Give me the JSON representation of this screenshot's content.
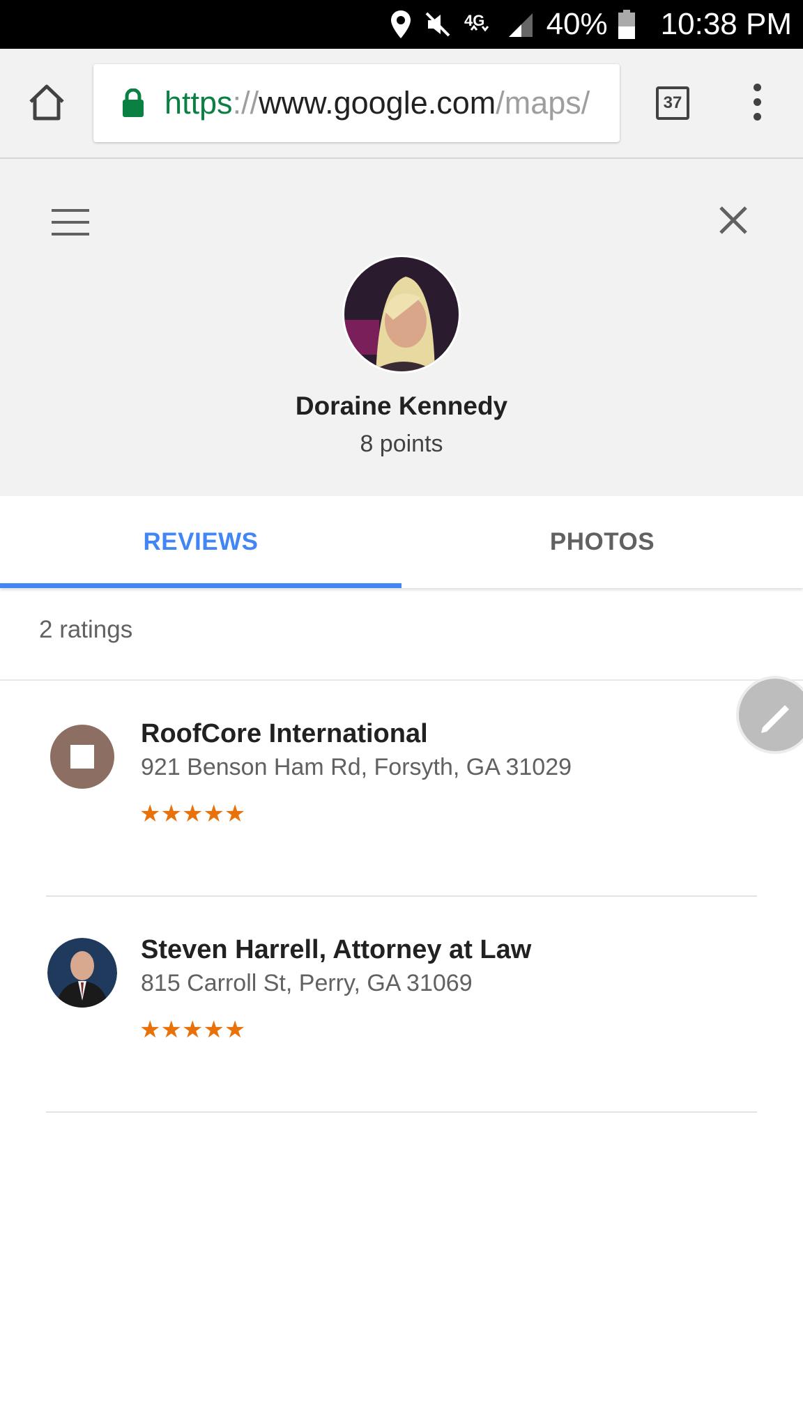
{
  "status_bar": {
    "battery_percent": "40%",
    "time": "10:38 PM",
    "network": "4G LTE",
    "icons": [
      "location-icon",
      "mute-icon",
      "lte-icon",
      "signal-icon",
      "battery-icon"
    ]
  },
  "browser": {
    "url_scheme": "https",
    "url_sep": "://",
    "url_host": "www.google.com",
    "url_path": "/maps/",
    "tab_count": "37",
    "icons": [
      "home-icon",
      "lock-icon",
      "tabs-icon",
      "overflow-menu-icon"
    ]
  },
  "profile": {
    "name": "Doraine Kennedy",
    "points": "8 points",
    "icons": [
      "hamburger-menu-icon",
      "close-icon"
    ]
  },
  "tabs": [
    {
      "label": "REVIEWS",
      "active": true
    },
    {
      "label": "PHOTOS",
      "active": false
    }
  ],
  "ratings_count": "2 ratings",
  "reviews": [
    {
      "name": "RoofCore International",
      "address": "921 Benson Ham Rd, Forsyth, GA 31029",
      "stars": "★★★★★",
      "rating": 5
    },
    {
      "name": "Steven Harrell, Attorney at Law",
      "address": "815 Carroll St, Perry, GA 31069",
      "stars": "★★★★★",
      "rating": 5
    }
  ],
  "colors": {
    "accent": "#4285f4",
    "star": "#e8710a",
    "secure_green": "#0b8043",
    "header_bg": "#f2f2f2"
  }
}
